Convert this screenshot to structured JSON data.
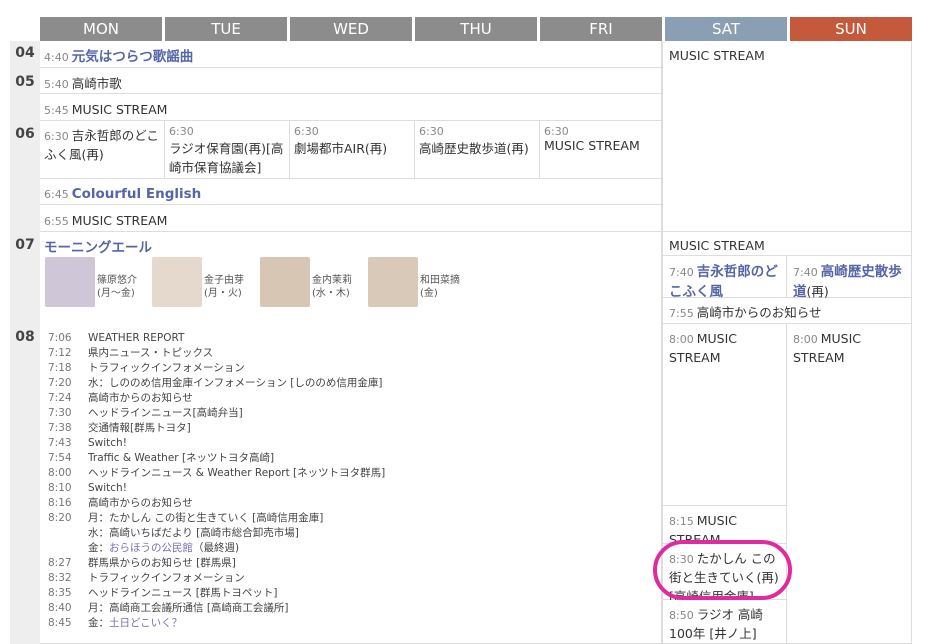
{
  "days": [
    "MON",
    "TUE",
    "WED",
    "THU",
    "FRI",
    "SAT",
    "SUN"
  ],
  "hours": [
    "04",
    "05",
    "06",
    "07",
    "08"
  ],
  "weekday": {
    "r04": {
      "time": "4:40",
      "title": "元気はつらつ歌謡曲"
    },
    "r05a": {
      "time": "5:40",
      "title": "高崎市歌"
    },
    "r05b": {
      "time": "5:45",
      "title": "MUSIC STREAM"
    },
    "r06": [
      {
        "time": "6:30",
        "title": "吉永哲郎のどこふく風(再)"
      },
      {
        "time": "6:30",
        "title": "ラジオ保育園(再)[高崎市保育協議会]"
      },
      {
        "time": "6:30",
        "title": "劇場都市AIR(再)"
      },
      {
        "time": "6:30",
        "title": "高崎歴史散歩道(再)"
      },
      {
        "time": "6:30",
        "title": "MUSIC STREAM"
      }
    ],
    "r06b": {
      "time": "6:45",
      "title": "Colourful English"
    },
    "r06c": {
      "time": "6:55",
      "title": "MUSIC STREAM"
    },
    "r07": {
      "title": "モーニングエール"
    },
    "personalities": [
      {
        "name": "篠原悠介",
        "days": "(月～金)"
      },
      {
        "name": "金子由芽",
        "days": "(月・火)"
      },
      {
        "name": "金内茉莉",
        "days": "(水・木)"
      },
      {
        "name": "和田菜摘",
        "days": "(金)"
      }
    ],
    "schedule": [
      {
        "time": "7:06",
        "text": "WEATHER REPORT"
      },
      {
        "time": "7:12",
        "text": "県内ニュース・トピックス"
      },
      {
        "time": "7:18",
        "text": "トラフィックインフォメーション"
      },
      {
        "time": "7:20",
        "text": "水：しののめ信用金庫インフォメーション [しののめ信用金庫]"
      },
      {
        "time": "7:24",
        "text": "高崎市からのお知らせ"
      },
      {
        "time": "7:30",
        "text": "ヘッドラインニュース[高崎弁当]"
      },
      {
        "time": "7:38",
        "text": "交通情報[群馬トヨタ]"
      },
      {
        "time": "7:43",
        "text": "Switch!"
      },
      {
        "time": "7:54",
        "text": "Traffic & Weather [ネッツトヨタ高崎]"
      },
      {
        "time": "8:00",
        "text": "ヘッドラインニュース & Weather Report [ネッツトヨタ群馬]"
      },
      {
        "time": "8:10",
        "text": "Switch!"
      },
      {
        "time": "8:16",
        "text": "高崎市からのお知らせ"
      },
      {
        "time": "8:20",
        "text": "月：たかしん この街と生きていく [高崎信用金庫]"
      },
      {
        "time": "",
        "text": "水：高崎いちばだより [高崎市総合卸売市場]"
      },
      {
        "time": "",
        "text": "金：",
        "link": "おらほうの公民館",
        "tail": "（最終週)"
      },
      {
        "time": "8:27",
        "text": "群馬県からのお知らせ [群馬県]"
      },
      {
        "time": "8:32",
        "text": "トラフィックインフォメーション"
      },
      {
        "time": "8:35",
        "text": "ヘッドラインニュース [群馬トヨペット]"
      },
      {
        "time": "8:40",
        "text": "月：高崎商工会議所通信 [高崎商工会議所]"
      },
      {
        "time": "8:45",
        "text": "金：",
        "link": "土日どこいく？",
        "tail": ""
      }
    ]
  },
  "weekend": {
    "sat_music1": "MUSIC STREAM",
    "sat_music2": "MUSIC STREAM",
    "sat_740": {
      "time": "7:40",
      "title": "吉永哲郎のどこふく風"
    },
    "sun_740": {
      "time": "7:40",
      "title": "高崎歴史散歩道",
      "suffix": "(再)"
    },
    "wk_755": {
      "time": "7:55",
      "title": "高崎市からのお知らせ"
    },
    "sat_800": {
      "time": "8:00",
      "title": "MUSIC STREAM"
    },
    "sun_800": {
      "time": "8:00",
      "title": "MUSIC STREAM"
    },
    "sat_815": {
      "time": "8:15",
      "title": "MUSIC STREAM"
    },
    "sat_830": {
      "time": "8:30",
      "title": "たかしん この街と生きていく(再)",
      "sub": "[高崎信用金庫]"
    },
    "sat_850": {
      "time": "8:50",
      "title": "ラジオ 高崎100年 [井ノ上]"
    }
  },
  "colors": {
    "weekday_header": "#8c8c8c",
    "sat_header": "#8a9fb3",
    "sun_header": "#c45a3b",
    "highlight": "#e02ba0"
  }
}
